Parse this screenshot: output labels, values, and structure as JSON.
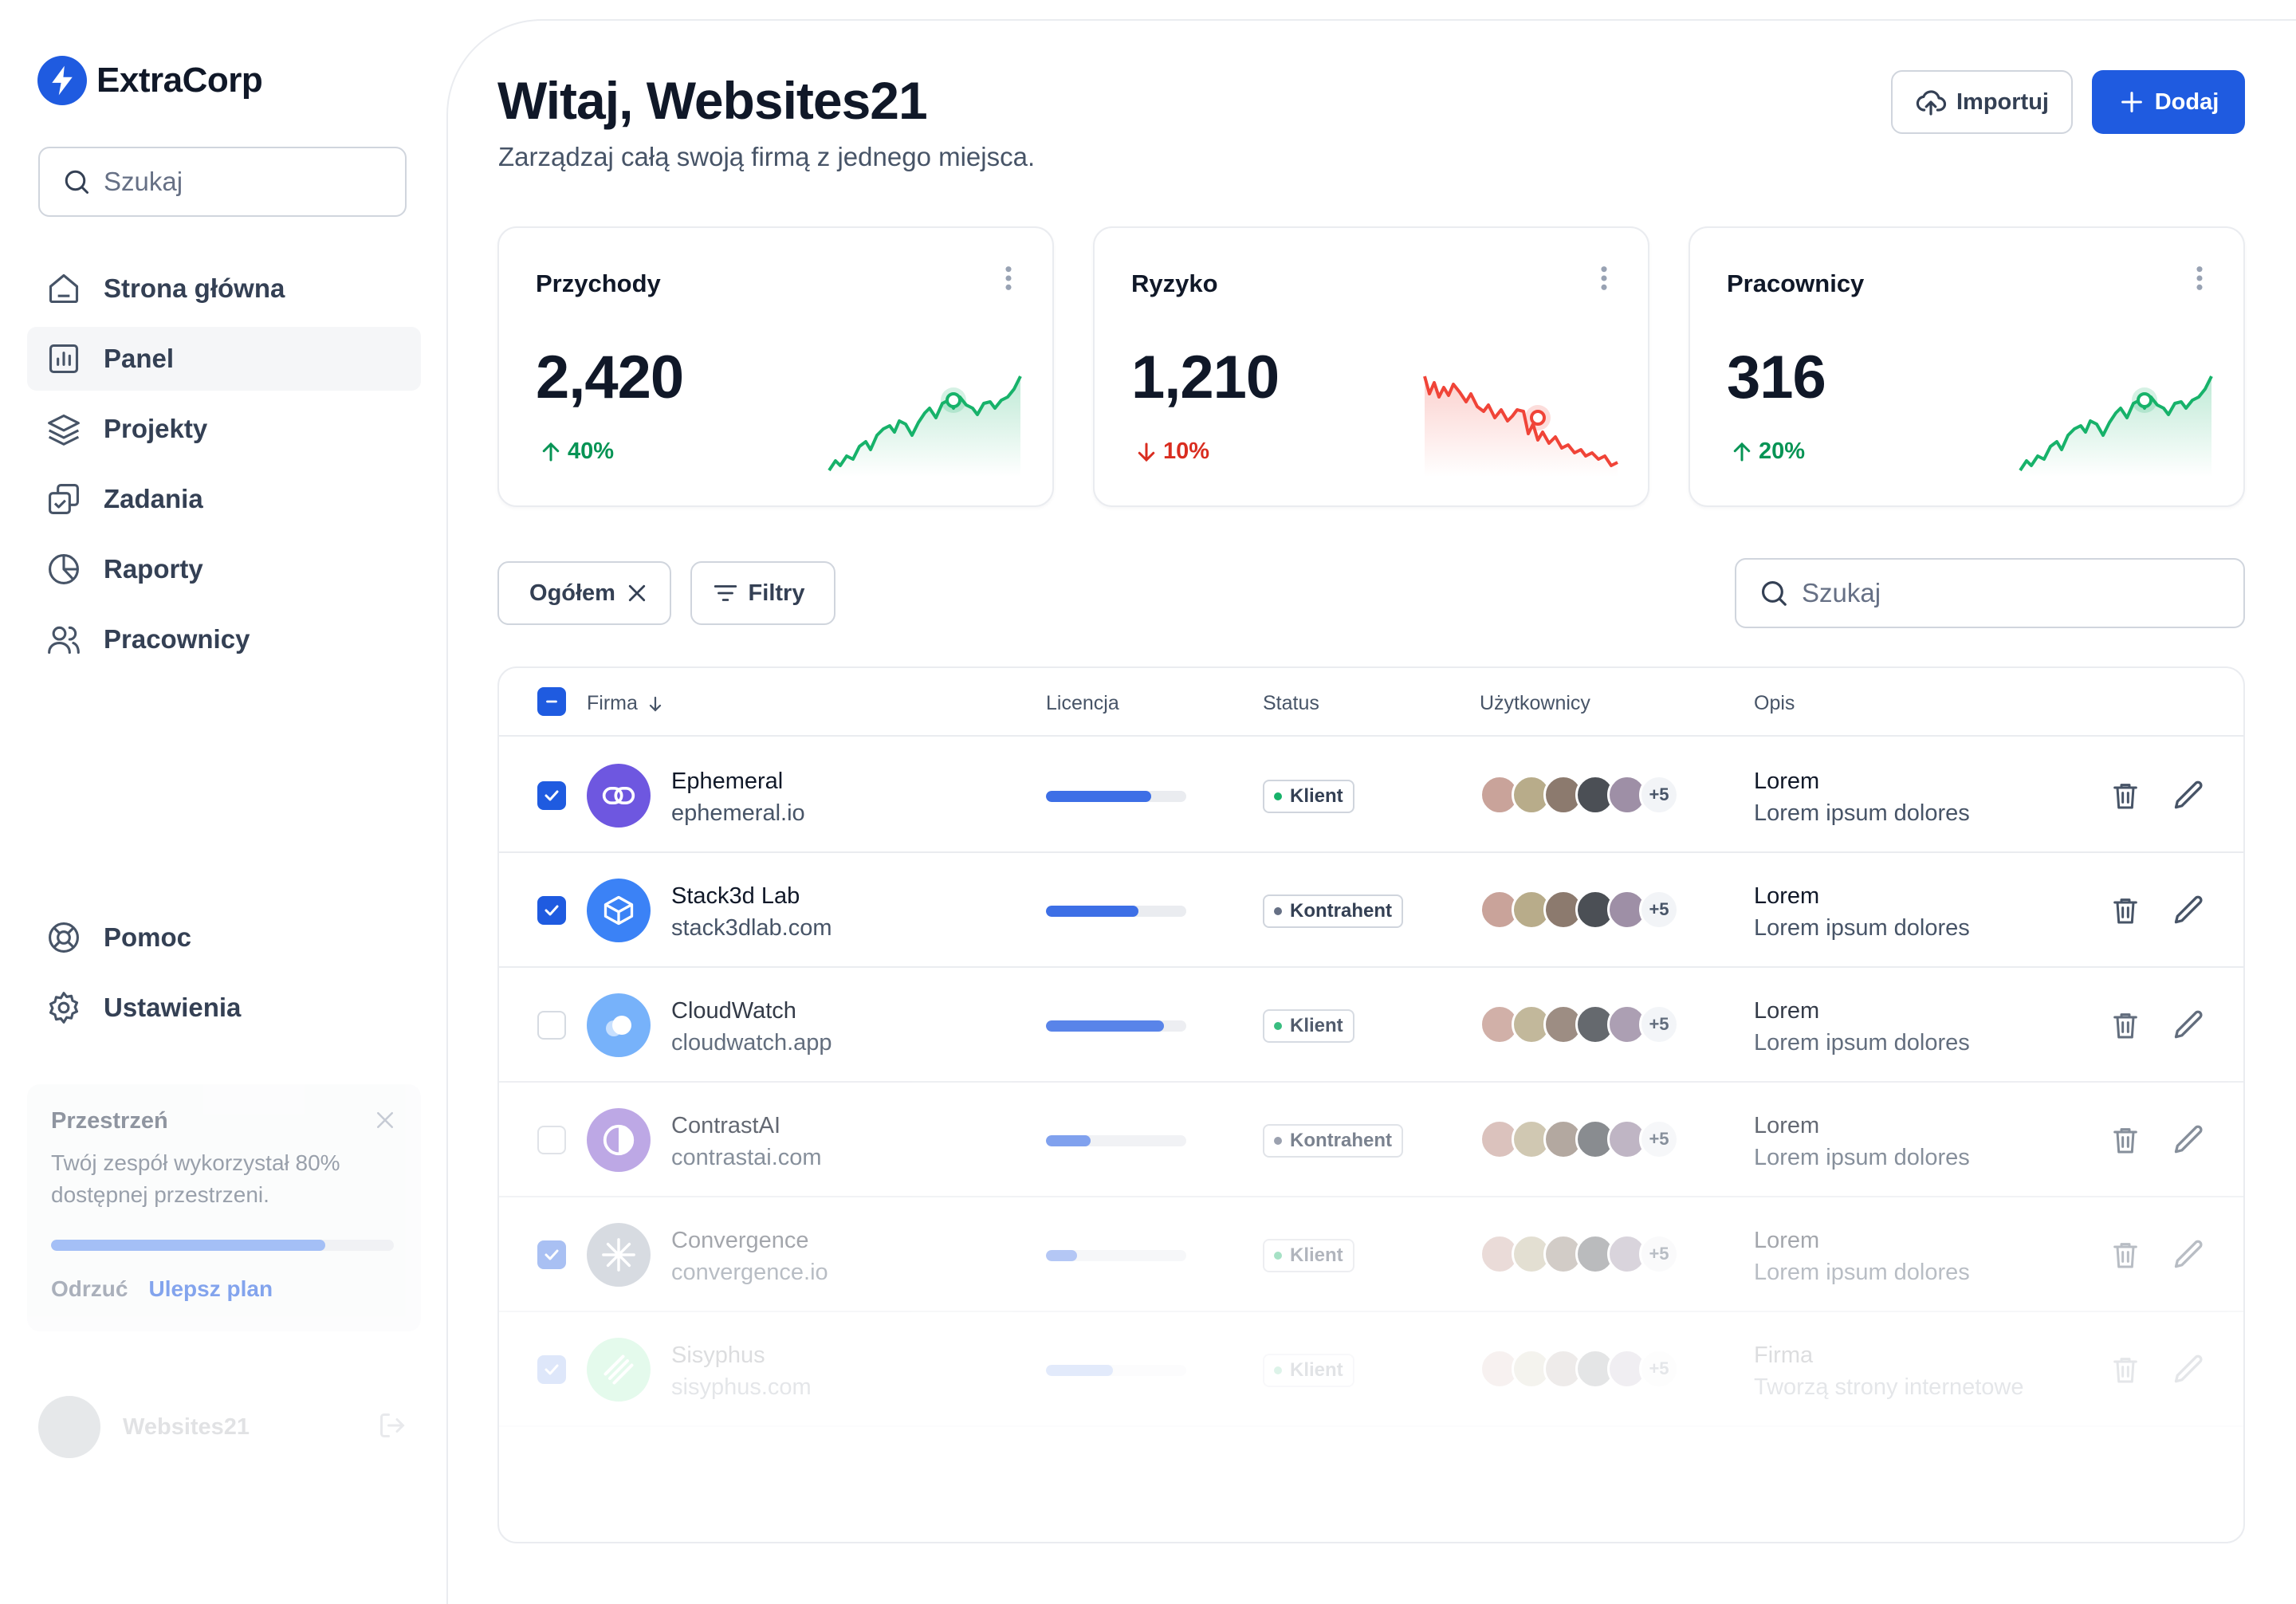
{
  "brand": {
    "name": "ExtraCorp",
    "accent": "#1f5be0"
  },
  "sidebar": {
    "search_placeholder": "Szukaj",
    "items": [
      {
        "label": "Strona główna",
        "icon": "home-icon",
        "active": false
      },
      {
        "label": "Panel",
        "icon": "bar-chart-icon",
        "active": true
      },
      {
        "label": "Projekty",
        "icon": "layers-icon",
        "active": false
      },
      {
        "label": "Zadania",
        "icon": "check-square-icon",
        "active": false
      },
      {
        "label": "Raporty",
        "icon": "pie-chart-icon",
        "active": false
      },
      {
        "label": "Pracownicy",
        "icon": "users-icon",
        "active": false
      }
    ],
    "bottom_items": [
      {
        "label": "Pomoc",
        "icon": "life-buoy-icon"
      },
      {
        "label": "Ustawienia",
        "icon": "settings-icon"
      }
    ],
    "space_card": {
      "title": "Przestrzeń",
      "description": "Twój zespół wykorzystał 80% dostępnej przestrzeni.",
      "usage": 0.8,
      "dismiss": "Odrzuć",
      "upgrade": "Ulepsz plan"
    },
    "user": {
      "name": "Websites21"
    }
  },
  "header": {
    "title": "Witaj, Websites21",
    "subtitle": "Zarządzaj całą swoją firmą z jednego miejsca.",
    "import_label": "Importuj",
    "add_label": "Dodaj"
  },
  "stats": [
    {
      "title": "Przychody",
      "value": "2,420",
      "change": "40%",
      "trend": "up",
      "color": "#17b26a"
    },
    {
      "title": "Ryzyko",
      "value": "1,210",
      "change": "10%",
      "trend": "down",
      "color": "#f04438"
    },
    {
      "title": "Pracownicy",
      "value": "316",
      "change": "20%",
      "trend": "up",
      "color": "#17b26a"
    }
  ],
  "filters": {
    "chip_label": "Ogółem",
    "filter_label": "Filtry",
    "search_placeholder": "Szukaj"
  },
  "table": {
    "columns": {
      "company": "Firma",
      "license": "Licencja",
      "status": "Status",
      "users": "Użytkownicy",
      "description": "Opis"
    },
    "rows": [
      {
        "name": "Ephemeral",
        "domain": "ephemeral.io",
        "license": 0.75,
        "status": "Klient",
        "status_color": "#17b26a",
        "extra_users": "+5",
        "desc_title": "Lorem",
        "desc": "Lorem ipsum dolores",
        "checked": true,
        "logo_color": "#6e57e0"
      },
      {
        "name": "Stack3d Lab",
        "domain": "stack3dlab.com",
        "license": 0.66,
        "status": "Kontrahent",
        "status_color": "#667085",
        "extra_users": "+5",
        "desc_title": "Lorem",
        "desc": "Lorem ipsum dolores",
        "checked": true,
        "logo_color": "#3b82f6"
      },
      {
        "name": "CloudWatch",
        "domain": "cloudwatch.app",
        "license": 0.84,
        "status": "Klient",
        "status_color": "#17b26a",
        "extra_users": "+5",
        "desc_title": "Lorem",
        "desc": "Lorem ipsum dolores",
        "checked": false,
        "logo_color": "#60a5fa"
      },
      {
        "name": "ContrastAI",
        "domain": "contrastai.com",
        "license": 0.32,
        "status": "Kontrahent",
        "status_color": "#667085",
        "extra_users": "+5",
        "desc_title": "Lorem",
        "desc": "Lorem ipsum dolores",
        "checked": false,
        "logo_color": "#9b7ad8"
      },
      {
        "name": "Convergence",
        "domain": "convergence.io",
        "license": 0.22,
        "status": "Klient",
        "status_color": "#17b26a",
        "extra_users": "+5",
        "desc_title": "Lorem",
        "desc": "Lorem ipsum dolores",
        "checked": true,
        "logo_color": "#98a2b3"
      },
      {
        "name": "Sisyphus",
        "domain": "sisyphus.com",
        "license": 0.48,
        "status": "Klient",
        "status_color": "#17b26a",
        "extra_users": "+5",
        "desc_title": "Firma",
        "desc": "Tworzą strony internetowe",
        "checked": true,
        "logo_color": "#4ade80"
      }
    ]
  }
}
